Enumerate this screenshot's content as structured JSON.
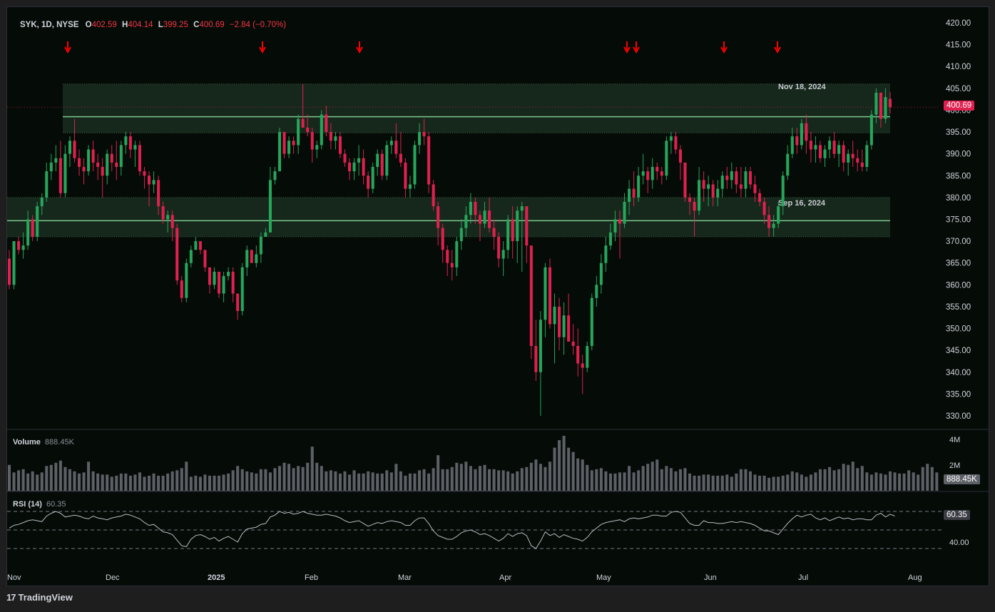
{
  "legend": {
    "symbol": "SYK, 1D, NYSE",
    "open_label": "O",
    "open": "402.59",
    "high_label": "H",
    "high": "404.14",
    "low_label": "L",
    "low": "399.25",
    "close_label": "C",
    "close": "400.69",
    "change": "−2.84 (−0.70%)"
  },
  "price_badge": "400.69",
  "volume_pane": {
    "title": "Volume",
    "value": "888.45K",
    "ticks": [
      "4M",
      "2M"
    ],
    "badge": "888.45K"
  },
  "rsi_pane": {
    "title": "RSI (14)",
    "value": "60.35",
    "ticks": [
      "40.00"
    ],
    "badge": "60.35"
  },
  "annotations": {
    "upper_label": "Nov 18, 2024",
    "lower_label": "Sep 16, 2024"
  },
  "footer": {
    "logo": "TradingView"
  },
  "colors": {
    "up": "#26a65b",
    "down": "#e0204f",
    "zone": "#1a2e1e",
    "zone_line": "#7ec98f",
    "arrow": "#ff0000",
    "grid": "#555a62"
  },
  "chart_data": {
    "type": "candlestick",
    "symbol": "SYK",
    "interval": "1D",
    "exchange": "NYSE",
    "y_ticks": [
      "420.00",
      "415.00",
      "410.00",
      "405.00",
      "400.00",
      "395.00",
      "390.00",
      "385.00",
      "380.00",
      "375.00",
      "370.00",
      "365.00",
      "360.00",
      "355.00",
      "350.00",
      "345.00",
      "340.00",
      "335.00",
      "330.00"
    ],
    "x_ticks": [
      "Nov",
      "Dec",
      "2025",
      "Feb",
      "Mar",
      "Apr",
      "May",
      "Jun",
      "Jul",
      "Aug"
    ],
    "ylim": [
      327,
      423
    ],
    "last_price": 400.69,
    "zones": [
      {
        "top": 406,
        "bottom": 394.8,
        "line": 398.5
      },
      {
        "top": 380,
        "bottom": 371,
        "line": 374.7
      }
    ],
    "candles": [
      [
        366,
        368,
        359,
        360
      ],
      [
        360,
        370,
        359,
        370
      ],
      [
        370,
        371,
        367,
        368
      ],
      [
        368,
        372,
        366,
        369
      ],
      [
        369,
        377,
        368,
        375
      ],
      [
        375,
        376,
        370,
        371
      ],
      [
        371,
        379,
        370,
        378
      ],
      [
        378,
        381,
        376,
        380
      ],
      [
        380,
        388,
        379,
        386
      ],
      [
        386,
        390,
        384,
        388
      ],
      [
        388,
        392,
        386,
        389
      ],
      [
        389,
        393,
        380,
        381
      ],
      [
        381,
        392,
        380,
        390
      ],
      [
        390,
        394,
        387,
        393
      ],
      [
        393,
        398,
        388,
        389
      ],
      [
        389,
        391,
        385,
        387
      ],
      [
        387,
        389,
        383,
        386
      ],
      [
        386,
        392,
        385,
        391
      ],
      [
        391,
        393,
        386,
        388
      ],
      [
        388,
        390,
        384,
        387
      ],
      [
        387,
        389,
        380,
        385
      ],
      [
        385,
        391,
        383,
        390
      ],
      [
        390,
        392,
        386,
        388
      ],
      [
        388,
        393,
        384,
        387
      ],
      [
        387,
        393,
        385,
        392
      ],
      [
        392,
        395,
        390,
        394
      ],
      [
        394,
        395,
        389,
        391
      ],
      [
        391,
        393,
        387,
        392
      ],
      [
        392,
        393,
        385,
        386
      ],
      [
        386,
        387,
        382,
        385
      ],
      [
        385,
        386,
        378,
        383
      ],
      [
        383,
        386,
        381,
        384
      ],
      [
        384,
        385,
        376,
        378
      ],
      [
        378,
        379,
        374,
        375
      ],
      [
        375,
        377,
        372,
        376
      ],
      [
        376,
        377,
        370,
        373
      ],
      [
        373,
        374,
        360,
        361
      ],
      [
        361,
        362,
        356,
        357
      ],
      [
        357,
        366,
        356,
        365
      ],
      [
        365,
        369,
        364,
        368
      ],
      [
        368,
        371,
        368,
        370
      ],
      [
        370,
        370,
        367,
        368
      ],
      [
        368,
        368,
        363,
        364
      ],
      [
        364,
        364,
        358,
        360
      ],
      [
        360,
        364,
        359,
        363
      ],
      [
        363,
        363,
        357,
        358
      ],
      [
        358,
        363,
        356,
        362
      ],
      [
        362,
        364,
        361,
        363
      ],
      [
        363,
        364,
        356,
        358
      ],
      [
        358,
        358,
        352,
        354
      ],
      [
        354,
        365,
        353,
        364
      ],
      [
        364,
        369,
        362,
        368
      ],
      [
        368,
        368,
        365,
        365
      ],
      [
        365,
        369,
        364,
        367
      ],
      [
        367,
        372,
        365,
        371
      ],
      [
        371,
        373,
        371,
        372
      ],
      [
        372,
        387,
        372,
        384
      ],
      [
        384,
        387,
        383,
        386
      ],
      [
        386,
        396,
        386,
        395
      ],
      [
        395,
        395,
        389,
        390
      ],
      [
        390,
        394,
        389,
        393
      ],
      [
        393,
        394,
        390,
        392
      ],
      [
        392,
        399,
        390,
        398
      ],
      [
        398,
        406,
        396,
        396
      ],
      [
        396,
        399,
        394,
        395
      ],
      [
        395,
        396,
        388,
        391
      ],
      [
        391,
        393,
        389,
        392
      ],
      [
        392,
        400,
        391,
        399
      ],
      [
        399,
        401,
        394,
        395
      ],
      [
        395,
        397,
        391,
        393
      ],
      [
        393,
        395,
        391,
        394
      ],
      [
        394,
        395,
        389,
        390
      ],
      [
        390,
        391,
        387,
        388
      ],
      [
        388,
        389,
        384,
        386
      ],
      [
        386,
        389,
        384,
        388
      ],
      [
        388,
        392,
        385,
        389
      ],
      [
        389,
        391,
        383,
        385
      ],
      [
        385,
        386,
        380,
        382
      ],
      [
        382,
        388,
        381,
        387
      ],
      [
        387,
        391,
        385,
        390
      ],
      [
        390,
        391,
        384,
        385
      ],
      [
        385,
        393,
        384,
        392
      ],
      [
        392,
        394,
        390,
        393
      ],
      [
        393,
        397,
        389,
        390
      ],
      [
        390,
        395,
        387,
        388
      ],
      [
        388,
        389,
        380,
        382
      ],
      [
        382,
        385,
        380,
        383
      ],
      [
        383,
        393,
        382,
        392
      ],
      [
        392,
        397,
        390,
        395
      ],
      [
        395,
        398,
        392,
        394
      ],
      [
        394,
        395,
        381,
        383
      ],
      [
        383,
        384,
        377,
        378
      ],
      [
        378,
        379,
        369,
        373
      ],
      [
        373,
        374,
        365,
        368
      ],
      [
        368,
        369,
        362,
        365
      ],
      [
        365,
        368,
        361,
        364
      ],
      [
        364,
        371,
        362,
        370
      ],
      [
        370,
        375,
        368,
        373
      ],
      [
        373,
        378,
        371,
        376
      ],
      [
        376,
        381,
        374,
        379
      ],
      [
        379,
        380,
        374,
        376
      ],
      [
        376,
        377,
        370,
        374
      ],
      [
        374,
        379,
        373,
        377
      ],
      [
        377,
        380,
        372,
        373
      ],
      [
        373,
        375,
        368,
        371
      ],
      [
        371,
        372,
        364,
        366
      ],
      [
        366,
        370,
        362,
        368
      ],
      [
        368,
        376,
        366,
        375
      ],
      [
        375,
        378,
        366,
        370
      ],
      [
        370,
        378,
        365,
        377
      ],
      [
        377,
        379,
        363,
        378
      ],
      [
        378,
        378,
        365,
        369
      ],
      [
        369,
        369,
        343,
        346
      ],
      [
        346,
        352,
        338,
        340
      ],
      [
        340,
        354,
        330,
        352
      ],
      [
        352,
        365,
        348,
        364
      ],
      [
        364,
        366,
        350,
        351
      ],
      [
        351,
        358,
        342,
        355
      ],
      [
        355,
        357,
        345,
        348
      ],
      [
        348,
        356,
        344,
        353
      ],
      [
        353,
        358,
        348,
        347
      ],
      [
        347,
        351,
        344,
        346
      ],
      [
        346,
        350,
        339,
        342
      ],
      [
        342,
        344,
        335,
        341
      ],
      [
        341,
        347,
        340,
        346
      ],
      [
        346,
        358,
        345,
        357
      ],
      [
        357,
        362,
        355,
        360
      ],
      [
        360,
        367,
        358,
        365
      ],
      [
        365,
        371,
        363,
        369
      ],
      [
        369,
        374,
        368,
        372
      ],
      [
        372,
        377,
        370,
        375
      ],
      [
        375,
        377,
        366,
        374
      ],
      [
        374,
        381,
        373,
        379
      ],
      [
        379,
        384,
        376,
        382
      ],
      [
        382,
        386,
        378,
        380
      ],
      [
        380,
        387,
        379,
        385
      ],
      [
        385,
        390,
        383,
        386
      ],
      [
        386,
        387,
        381,
        384
      ],
      [
        384,
        389,
        382,
        387
      ],
      [
        387,
        388,
        384,
        386
      ],
      [
        386,
        387,
        383,
        385
      ],
      [
        385,
        394,
        384,
        393
      ],
      [
        393,
        395,
        390,
        394
      ],
      [
        394,
        395,
        390,
        391
      ],
      [
        391,
        392,
        384,
        388
      ],
      [
        388,
        388,
        379,
        380
      ],
      [
        380,
        381,
        376,
        379
      ],
      [
        379,
        380,
        371,
        377
      ],
      [
        377,
        387,
        376,
        384
      ],
      [
        384,
        386,
        379,
        382
      ],
      [
        382,
        385,
        378,
        383
      ],
      [
        383,
        384,
        378,
        380
      ],
      [
        380,
        384,
        378,
        382
      ],
      [
        382,
        386,
        380,
        385
      ],
      [
        385,
        387,
        382,
        384
      ],
      [
        384,
        388,
        382,
        386
      ],
      [
        386,
        387,
        381,
        383
      ],
      [
        383,
        387,
        380,
        382
      ],
      [
        382,
        387,
        380,
        386
      ],
      [
        386,
        387,
        382,
        383
      ],
      [
        383,
        385,
        379,
        381
      ],
      [
        381,
        382,
        378,
        379
      ],
      [
        379,
        380,
        374,
        376
      ],
      [
        376,
        378,
        371,
        373
      ],
      [
        373,
        376,
        371,
        374
      ],
      [
        374,
        379,
        373,
        378
      ],
      [
        378,
        386,
        376,
        385
      ],
      [
        385,
        392,
        384,
        390
      ],
      [
        390,
        396,
        389,
        394
      ],
      [
        394,
        396,
        390,
        392
      ],
      [
        392,
        398,
        391,
        397
      ],
      [
        397,
        399,
        390,
        393
      ],
      [
        393,
        395,
        388,
        391
      ],
      [
        391,
        394,
        388,
        392
      ],
      [
        392,
        393,
        388,
        389
      ],
      [
        389,
        392,
        387,
        391
      ],
      [
        391,
        394,
        389,
        393
      ],
      [
        393,
        395,
        389,
        390
      ],
      [
        390,
        393,
        387,
        392
      ],
      [
        392,
        393,
        386,
        388
      ],
      [
        388,
        391,
        385,
        390
      ],
      [
        390,
        393,
        387,
        389
      ],
      [
        389,
        391,
        386,
        388
      ],
      [
        388,
        391,
        386,
        387
      ],
      [
        387,
        393,
        386,
        392
      ],
      [
        392,
        400,
        391,
        399
      ],
      [
        399,
        405,
        397,
        404
      ],
      [
        404,
        404,
        396,
        398
      ],
      [
        398,
        405,
        397,
        403
      ],
      [
        402.59,
        404.14,
        399.25,
        400.69
      ]
    ],
    "volume": [
      2.4,
      1.7,
      1.9,
      2.0,
      1.6,
      1.8,
      1.5,
      1.7,
      2.3,
      2.4,
      2.6,
      2.8,
      2.2,
      2.0,
      1.8,
      1.6,
      1.7,
      2.7,
      1.8,
      1.6,
      1.5,
      1.5,
      1.3,
      1.4,
      1.6,
      1.6,
      1.4,
      1.5,
      1.7,
      1.3,
      1.4,
      1.6,
      1.4,
      1.4,
      1.6,
      1.8,
      1.9,
      2.1,
      2.7,
      1.3,
      1.4,
      1.3,
      1.5,
      1.4,
      1.4,
      1.4,
      1.5,
      1.6,
      1.9,
      2.3,
      2.0,
      1.8,
      1.7,
      1.6,
      2.0,
      2.0,
      1.7,
      2.1,
      2.3,
      2.6,
      2.5,
      2.1,
      2.3,
      2.2,
      2.6,
      4.1,
      2.6,
      2.3,
      1.8,
      1.9,
      1.8,
      1.6,
      1.8,
      1.5,
      1.9,
      1.6,
      1.6,
      1.8,
      1.7,
      1.6,
      1.6,
      1.9,
      1.7,
      2.5,
      1.8,
      1.4,
      1.6,
      1.6,
      1.9,
      2.0,
      1.6,
      2.1,
      3.3,
      2.0,
      2.0,
      2.2,
      2.6,
      2.5,
      2.7,
      2.3,
      2.0,
      2.3,
      2.4,
      2.0,
      2.0,
      1.9,
      1.9,
      1.8,
      1.6,
      1.8,
      2.1,
      2.2,
      2.6,
      2.9,
      2.5,
      2.2,
      2.7,
      4.0,
      4.7,
      5.1,
      4.0,
      3.6,
      3.0,
      2.9,
      2.4,
      1.9,
      2.0,
      2.1,
      1.8,
      1.6,
      1.6,
      1.7,
      1.7,
      2.3,
      1.7,
      1.9,
      2.3,
      2.5,
      2.7,
      2.9,
      2.0,
      2.3,
      2.1,
      1.8,
      2.0,
      2.1,
      1.6,
      1.4,
      1.4,
      1.5,
      1.5,
      1.4,
      1.4,
      1.4,
      1.5,
      1.3,
      1.6,
      2.0,
      2.0,
      1.8,
      1.5,
      1.4,
      1.4,
      1.2,
      1.3,
      1.3,
      1.4,
      1.5,
      1.8,
      1.7,
      1.5,
      1.3,
      1.5,
      1.7,
      2.0,
      2.0,
      2.2,
      1.9,
      2.0,
      2.5,
      2.4,
      2.7,
      2.1,
      2.3,
      1.7,
      1.5,
      1.7,
      1.6,
      1.5,
      1.8,
      1.7,
      1.6,
      1.6,
      1.9,
      1.7,
      1.5,
      2.2,
      2.5,
      2.2,
      1.7
    ],
    "rsi_ticks_levels": [
      70,
      50,
      30
    ],
    "rsi": [
      52,
      55,
      56,
      58,
      60,
      61,
      60,
      59,
      65,
      68,
      70,
      68,
      64,
      65,
      66,
      65,
      63,
      62,
      65,
      63,
      62,
      61,
      63,
      64,
      65,
      67,
      66,
      64,
      62,
      58,
      55,
      56,
      52,
      48,
      47,
      45,
      39,
      33,
      32,
      40,
      44,
      45,
      43,
      40,
      42,
      38,
      41,
      43,
      40,
      37,
      46,
      51,
      52,
      53,
      56,
      57,
      64,
      66,
      70,
      68,
      69,
      67,
      68,
      70,
      68,
      67,
      66,
      66,
      67,
      66,
      65,
      63,
      60,
      58,
      59,
      60,
      57,
      54,
      56,
      58,
      57,
      59,
      60,
      59,
      58,
      55,
      55,
      60,
      63,
      63,
      57,
      49,
      44,
      42,
      40,
      40,
      43,
      47,
      49,
      50,
      48,
      45,
      46,
      44,
      41,
      38,
      41,
      46,
      43,
      46,
      47,
      44,
      33,
      30,
      38,
      48,
      44,
      46,
      42,
      45,
      43,
      41,
      40,
      38,
      42,
      48,
      52,
      56,
      58,
      59,
      60,
      61,
      59,
      62,
      63,
      62,
      63,
      64,
      66,
      66,
      65,
      65,
      69,
      70,
      69,
      63,
      57,
      55,
      55,
      60,
      58,
      58,
      57,
      57,
      58,
      59,
      58,
      59,
      58,
      57,
      55,
      52,
      49,
      49,
      47,
      45,
      51,
      57,
      62,
      66,
      64,
      66,
      67,
      63,
      61,
      63,
      60,
      62,
      64,
      62,
      63,
      61,
      62,
      62,
      61,
      61,
      66,
      68,
      64,
      67,
      65
    ]
  }
}
